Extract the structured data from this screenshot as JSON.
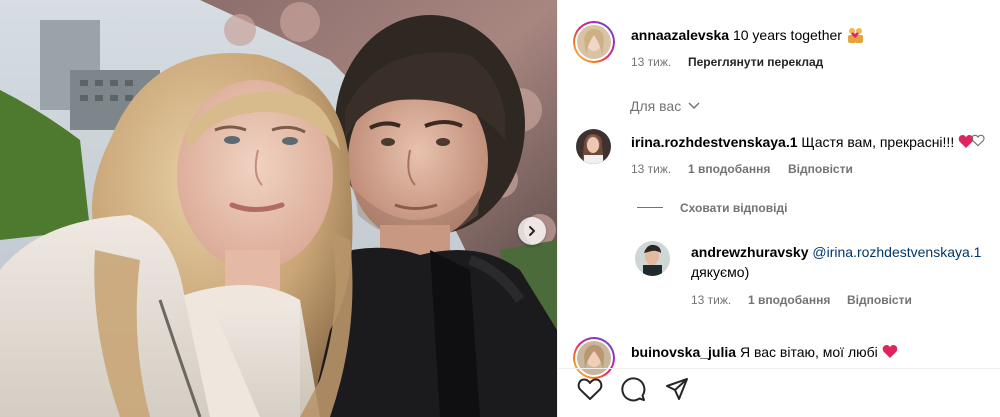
{
  "post": {
    "author": "annaazalevska",
    "caption": "10 years together",
    "caption_emoji_icon": "couple-with-heart-icon",
    "time": "13 тиж.",
    "translate_label": "Переглянути переклад"
  },
  "sort": {
    "label": "Для вас",
    "icon": "chevron-down-icon"
  },
  "comments": [
    {
      "username": "irina.rozhdestvenskaya.1",
      "text": "Щастя вам, прекрасні!!!",
      "emoji_icon": "red-heart-icon",
      "time": "13 тиж.",
      "likes": "1 вподобання",
      "reply_label": "Відповісти",
      "replies_toggle": "Сховати відповіді",
      "like_icon": "heart-outline-icon"
    },
    {
      "username": "buinovska_julia",
      "text": "Я вас вітаю, мої любі",
      "emoji_icon": "red-heart-icon"
    }
  ],
  "reply": {
    "username": "andrewzhuravsky",
    "mention": "@irina.rozhdestvenskaya.1",
    "text": "дякуємо)",
    "time": "13 тиж.",
    "likes": "1 вподобання",
    "reply_label": "Відповісти"
  },
  "actions": {
    "like_icon": "heart-outline-icon",
    "comment_icon": "comment-bubble-icon",
    "share_icon": "paper-plane-icon"
  },
  "carousel": {
    "next_icon": "chevron-right-icon"
  },
  "colors": {
    "link": "#00376b",
    "muted": "#737373",
    "heart": "#e0245e"
  }
}
